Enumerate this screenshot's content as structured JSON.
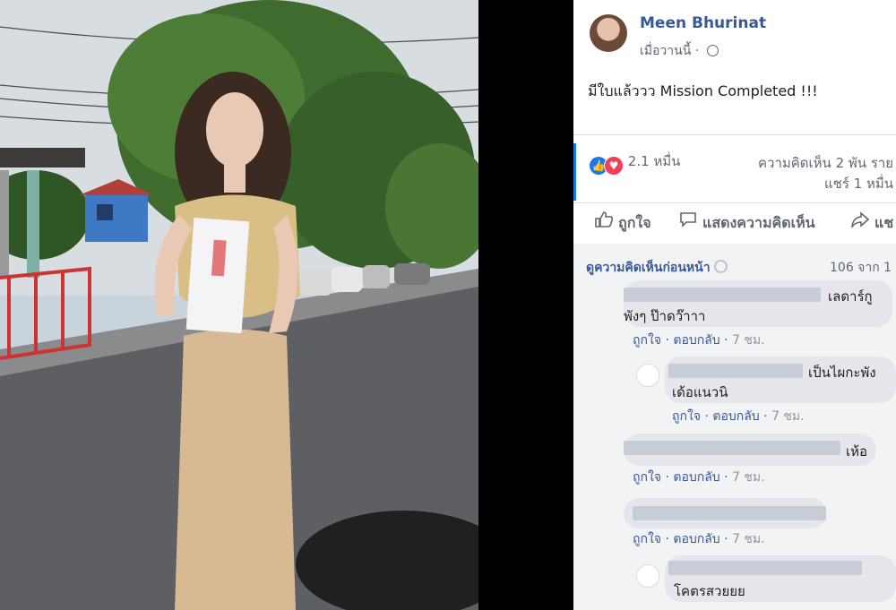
{
  "post": {
    "author": "Meen Bhurinat",
    "time": "เมื่อวานนี้",
    "separator": "·",
    "text": "มีใบแล้ววว Mission Completed !!!"
  },
  "stats": {
    "reactions": "2.1 หมื่น",
    "comments": "ความคิดเห็น 2 พัน ราย",
    "shares": "แชร์ 1 หมื่น"
  },
  "actions": {
    "like": "ถูกใจ",
    "comment": "แสดงความคิดเห็น",
    "share": "แช"
  },
  "comments_header": {
    "view_previous": "ดูความคิดเห็นก่อนหน้า",
    "count": "106 จาก 1"
  },
  "comments": [
    {
      "line1_tail": "เลดาร์กู",
      "line2": "พังๆ ป๊าดว๊าาา",
      "like": "ถูกใจ",
      "reply": "ตอบกลับ",
      "time": "7 ชม."
    },
    {
      "line1_tail": "เป็นไผกะพัง",
      "line2": "เด้อแนวนิ",
      "like": "ถูกใจ",
      "reply": "ตอบกลับ",
      "time": "7 ชม."
    },
    {
      "line1_tail": "เห้อ",
      "like": "ถูกใจ",
      "reply": "ตอบกลับ",
      "time": "7 ชม."
    },
    {
      "like": "ถูกใจ",
      "reply": "ตอบกลับ",
      "time": "7 ชม."
    },
    {
      "line2": "โคตรสวยยย"
    }
  ],
  "icons": {
    "like": "thumbs-up-icon",
    "comment": "speech-bubble-icon",
    "share": "share-arrow-icon",
    "privacy": "globe-icon",
    "reaction_like": "like-reaction-icon",
    "reaction_love": "love-reaction-icon"
  },
  "colors": {
    "link": "#385898",
    "like": "#1877f2",
    "love": "#f33e58",
    "comment_bubble": "#e4e6eb"
  }
}
